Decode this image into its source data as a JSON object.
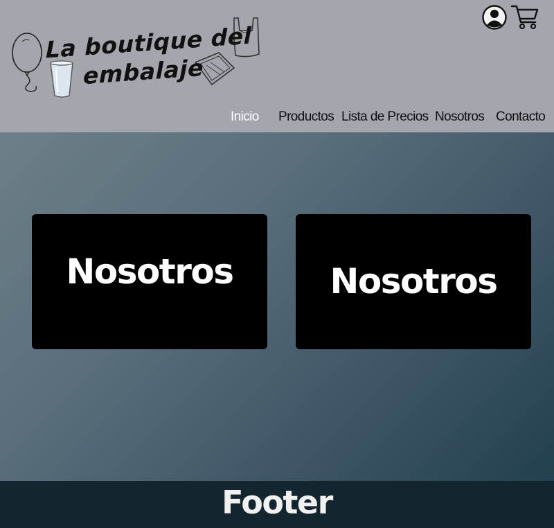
{
  "header": {
    "logo": {
      "line1": "La boutique del",
      "line2": "embalaje"
    },
    "icons": [
      "user-icon",
      "cart-icon"
    ]
  },
  "nav": {
    "items": [
      {
        "label": "Inicio",
        "active": true
      },
      {
        "label": "Productos"
      },
      {
        "label": "Lista de Precios"
      },
      {
        "label": "Nosotros"
      },
      {
        "label": "Contacto"
      }
    ]
  },
  "cards": [
    {
      "title": "Nosotros"
    },
    {
      "title": "Nosotros"
    }
  ],
  "footer": {
    "text": "Footer"
  },
  "colors": {
    "header_bg": "#a4a5ad",
    "nav_active": "#ffffff",
    "card_bg": "#000000",
    "footer_bg": "#13252e"
  }
}
